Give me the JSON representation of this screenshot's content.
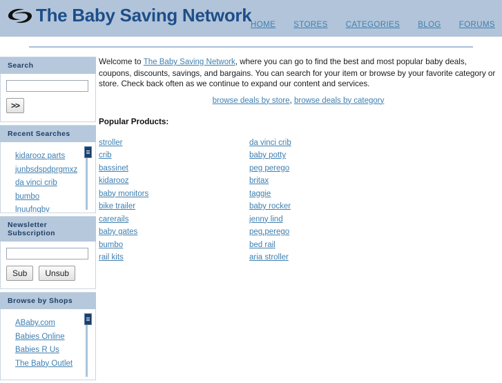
{
  "header": {
    "logo_icon": "swirl-logo-icon",
    "title": "The Baby Saving Network",
    "nav": [
      {
        "label": "HOME"
      },
      {
        "label": "STORES"
      },
      {
        "label": "CATEGORIES"
      },
      {
        "label": "BLOG"
      },
      {
        "label": "FORUMS"
      }
    ]
  },
  "sidebar": {
    "search": {
      "heading": "Search",
      "input_value": "",
      "input_placeholder": "",
      "submit_label": ">>"
    },
    "recent_searches": {
      "heading": "Recent Searches",
      "items": [
        {
          "label": "kidarooz parts"
        },
        {
          "label": "junbsdspdprgmxz"
        },
        {
          "label": "da vinci crib"
        },
        {
          "label": "bumbo"
        },
        {
          "label": "lnuufnqbv"
        }
      ]
    },
    "newsletter": {
      "heading": "Newsletter Subscription",
      "input_value": "",
      "input_placeholder": "",
      "sub_label": "Sub",
      "unsub_label": "Unsub"
    },
    "shops": {
      "heading": "Browse by Shops",
      "items": [
        {
          "label": "ABaby.com"
        },
        {
          "label": "Babies Online"
        },
        {
          "label": "Babies R Us"
        },
        {
          "label": "The Baby Outlet"
        }
      ]
    }
  },
  "main": {
    "intro": {
      "before_link": "Welcome to ",
      "link_label": "The Baby Saving Network",
      "after_link": ", where you can go to find the best and most popular baby deals, coupons, discounts, savings, and bargains. You can search for your item or browse by your favorite category or store. Check back often as we continue to expand our content and services."
    },
    "browse_links": {
      "by_store": "browse deals by store",
      "separator": ", ",
      "by_category": "browse deals by category"
    },
    "popular_products_title": "Popular Products:",
    "products_col1": [
      {
        "label": "stroller"
      },
      {
        "label": "crib"
      },
      {
        "label": "bassinet"
      },
      {
        "label": "kidarooz"
      },
      {
        "label": "baby monitors"
      },
      {
        "label": "bike trailer"
      },
      {
        "label": "carerails"
      },
      {
        "label": "baby gates"
      },
      {
        "label": "bumbo"
      },
      {
        "label": "rail kits"
      }
    ],
    "products_col2": [
      {
        "label": "da vinci crib"
      },
      {
        "label": "baby potty"
      },
      {
        "label": "peg perego"
      },
      {
        "label": "britax"
      },
      {
        "label": "taggie"
      },
      {
        "label": "baby rocker"
      },
      {
        "label": "jenny lind"
      },
      {
        "label": "peg,perego"
      },
      {
        "label": "bed rail"
      },
      {
        "label": "aria stroller"
      }
    ]
  },
  "colors": {
    "header_bg": "#b2c4d9",
    "brand_text": "#1d4e89",
    "link": "#3f7fb0",
    "panel_head_bg": "#b6c8dc",
    "panel_head_text": "#1f3f66",
    "scrollbar_thumb": "#1b3f6b"
  }
}
